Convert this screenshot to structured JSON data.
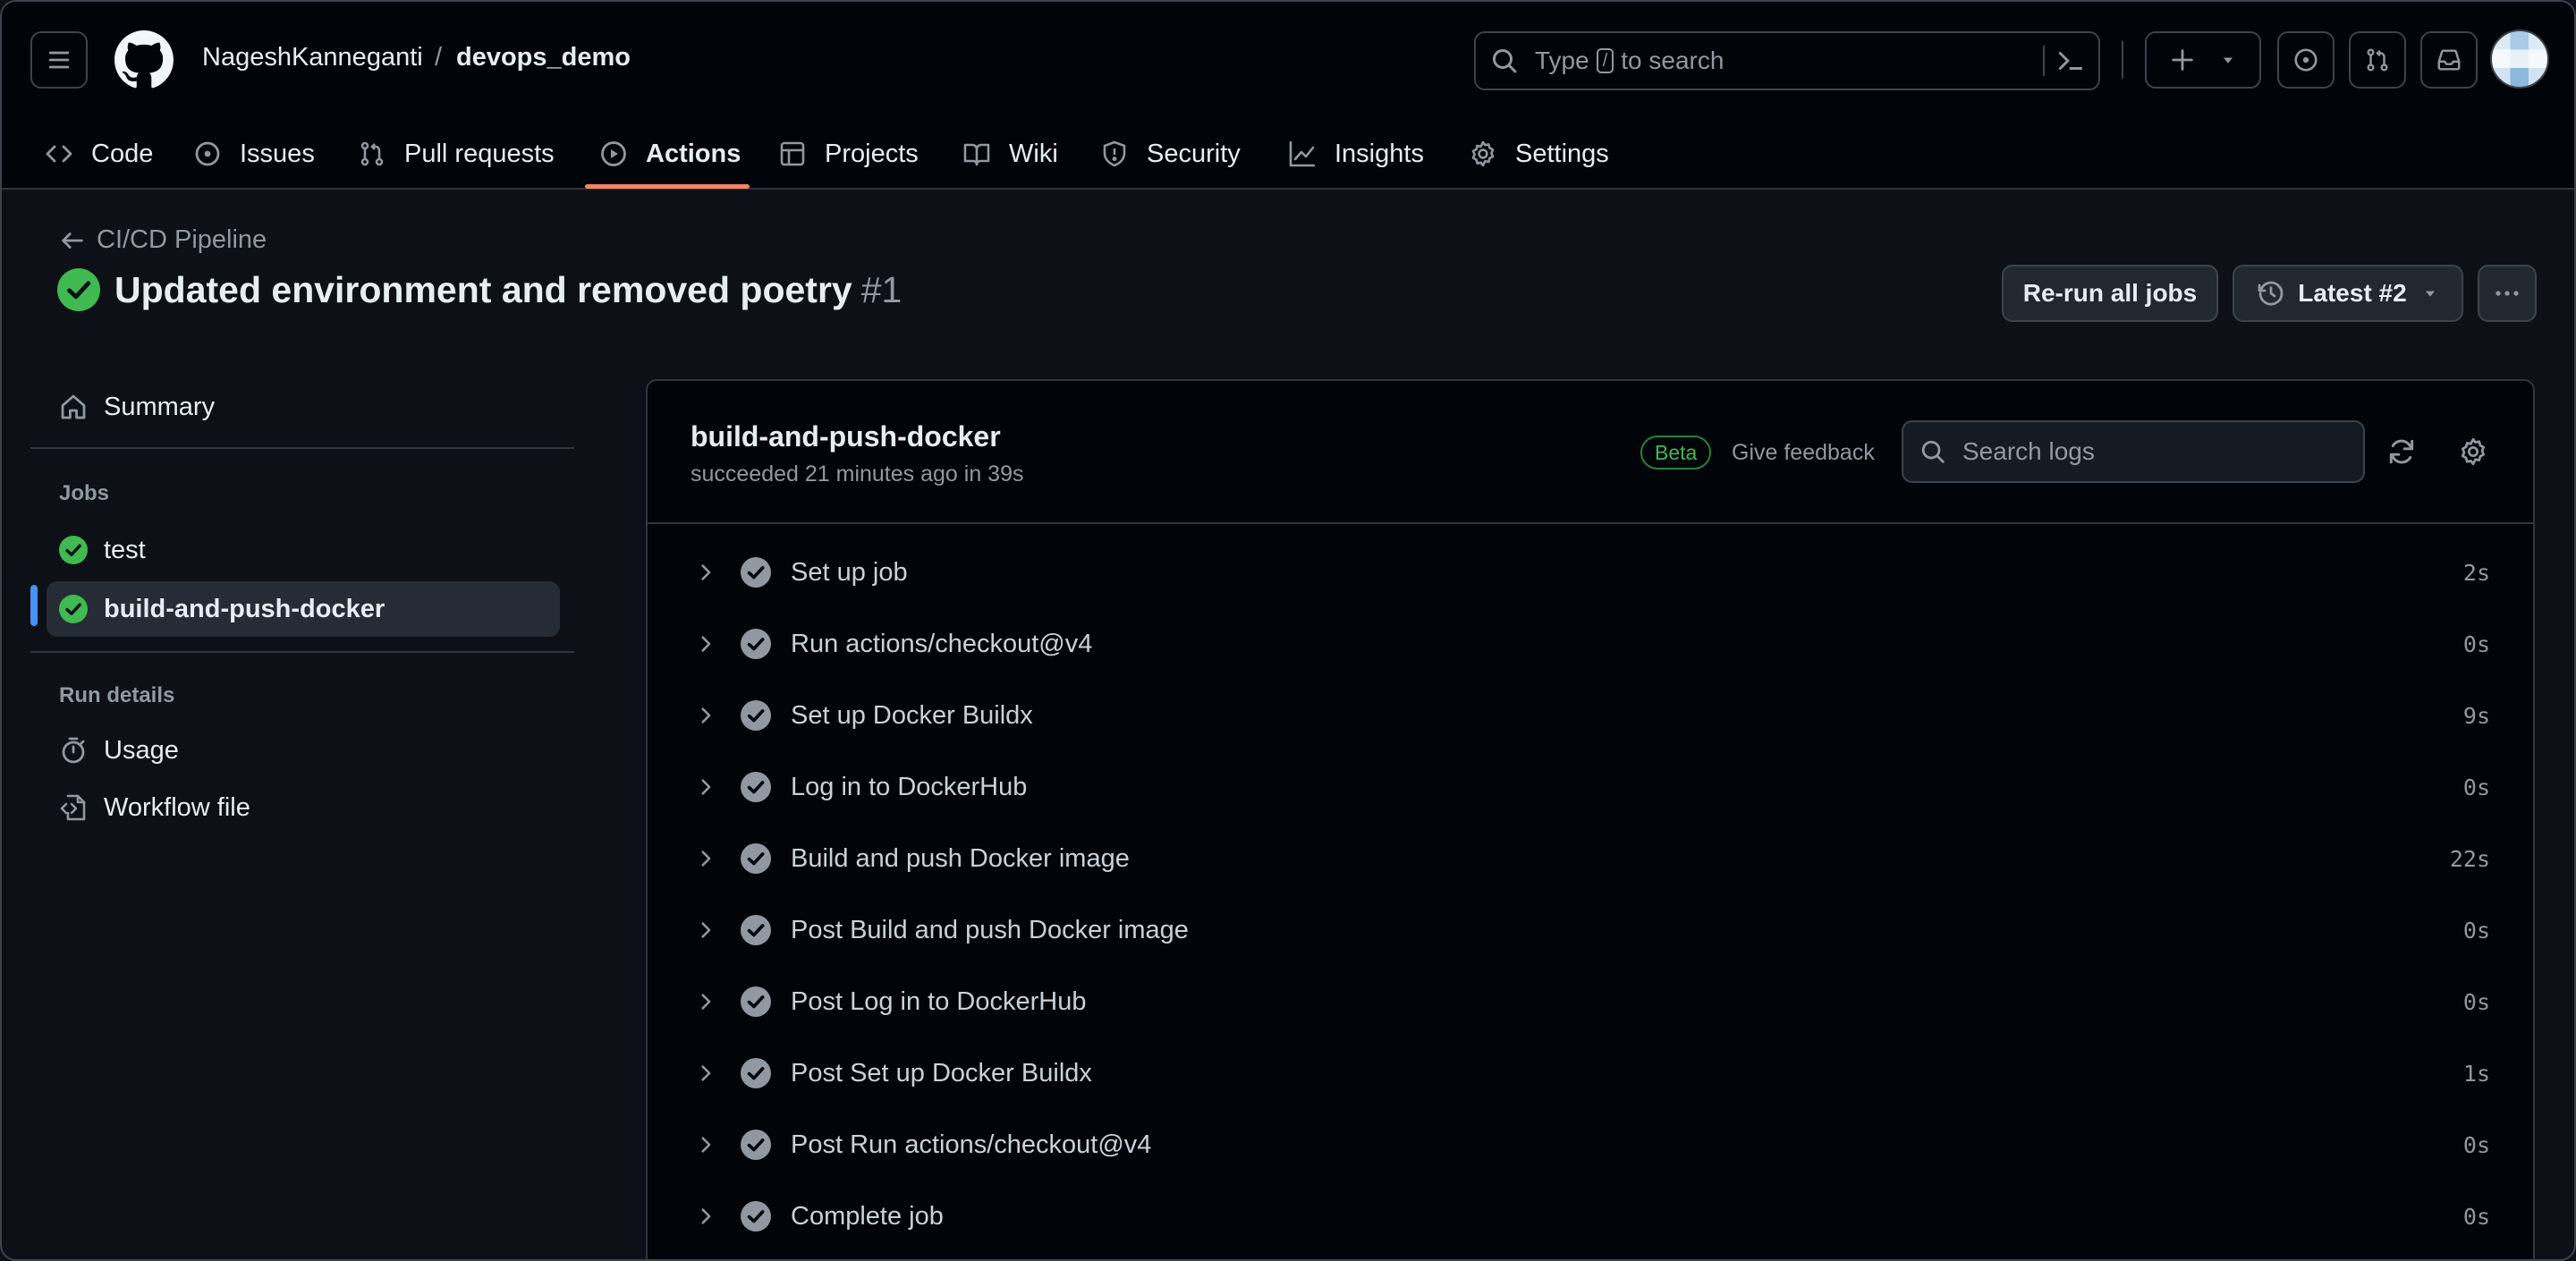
{
  "header": {
    "owner": "NageshKanneganti",
    "separator": "/",
    "repo": "devops_demo",
    "search": {
      "prefix": "Type",
      "key": "/",
      "suffix": "to search"
    }
  },
  "tabs": [
    {
      "label": "Code",
      "icon": "code-icon"
    },
    {
      "label": "Issues",
      "icon": "issue-icon"
    },
    {
      "label": "Pull requests",
      "icon": "pull-request-icon"
    },
    {
      "label": "Actions",
      "icon": "play-icon",
      "active": true
    },
    {
      "label": "Projects",
      "icon": "table-icon"
    },
    {
      "label": "Wiki",
      "icon": "book-icon"
    },
    {
      "label": "Security",
      "icon": "shield-icon"
    },
    {
      "label": "Insights",
      "icon": "graph-icon"
    },
    {
      "label": "Settings",
      "icon": "gear-icon"
    }
  ],
  "run": {
    "back_label": "CI/CD Pipeline",
    "title": "Updated environment and removed poetry",
    "number": "#1",
    "rerun_label": "Re-run all jobs",
    "attempt_label": "Latest #2"
  },
  "sidebar": {
    "summary": "Summary",
    "jobs_heading": "Jobs",
    "jobs": [
      {
        "label": "test",
        "status": "success"
      },
      {
        "label": "build-and-push-docker",
        "status": "success",
        "selected": true
      }
    ],
    "details_heading": "Run details",
    "details": [
      {
        "label": "Usage",
        "icon": "stopwatch-icon"
      },
      {
        "label": "Workflow file",
        "icon": "file-code-icon"
      }
    ]
  },
  "job": {
    "name": "build-and-push-docker",
    "status": "succeeded 21 minutes ago in 39s",
    "beta": "Beta",
    "feedback": "Give feedback",
    "search_placeholder": "Search logs",
    "steps": [
      {
        "name": "Set up job",
        "duration": "2s"
      },
      {
        "name": "Run actions/checkout@v4",
        "duration": "0s"
      },
      {
        "name": "Set up Docker Buildx",
        "duration": "9s"
      },
      {
        "name": "Log in to DockerHub",
        "duration": "0s"
      },
      {
        "name": "Build and push Docker image",
        "duration": "22s"
      },
      {
        "name": "Post Build and push Docker image",
        "duration": "0s"
      },
      {
        "name": "Post Log in to DockerHub",
        "duration": "0s"
      },
      {
        "name": "Post Set up Docker Buildx",
        "duration": "1s"
      },
      {
        "name": "Post Run actions/checkout@v4",
        "duration": "0s"
      },
      {
        "name": "Complete job",
        "duration": "0s"
      }
    ]
  },
  "colors": {
    "accent_tab": "#f78166",
    "success": "#3fb950",
    "selected_bar": "#4493f8"
  }
}
